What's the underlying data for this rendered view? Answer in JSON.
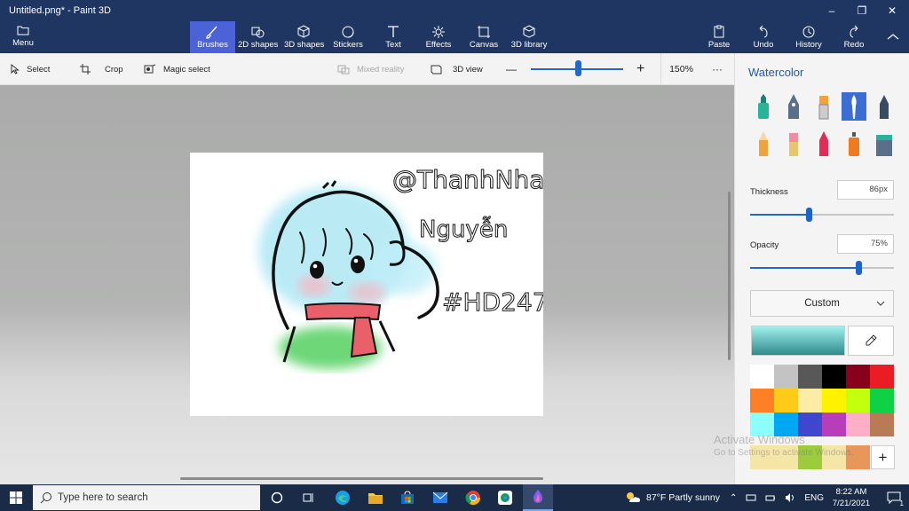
{
  "window": {
    "title": "Untitled.png* - Paint 3D",
    "controls": {
      "minimize": "–",
      "maximize": "❐",
      "close": "✕"
    }
  },
  "ribbon": {
    "menu_label": "Menu",
    "tools": [
      {
        "label": "Brushes",
        "icon": "brush-icon",
        "active": true
      },
      {
        "label": "2D shapes",
        "icon": "2d-shapes-icon"
      },
      {
        "label": "3D shapes",
        "icon": "3d-shapes-icon"
      },
      {
        "label": "Stickers",
        "icon": "stickers-icon"
      },
      {
        "label": "Text",
        "icon": "text-icon"
      },
      {
        "label": "Effects",
        "icon": "effects-icon"
      },
      {
        "label": "Canvas",
        "icon": "canvas-icon"
      },
      {
        "label": "3D library",
        "icon": "3d-library-icon"
      }
    ],
    "actions": [
      {
        "label": "Paste",
        "icon": "paste-icon"
      },
      {
        "label": "Undo",
        "icon": "undo-icon"
      },
      {
        "label": "History",
        "icon": "history-icon"
      },
      {
        "label": "Redo",
        "icon": "redo-icon"
      }
    ]
  },
  "toolbar": {
    "select_label": "Select",
    "crop_label": "Crop",
    "magic_select_label": "Magic select",
    "mixed_reality_label": "Mixed reality",
    "view_3d_label": "3D view",
    "zoom_minus": "—",
    "zoom_plus": "+",
    "zoom_value": "150%",
    "more": "···"
  },
  "canvas_text": {
    "line1": "@ThanhNhan",
    "line2": "Nguyễn",
    "line3": "#HD247"
  },
  "panel": {
    "title": "Watercolor",
    "selected_brush": "watercolor-brush",
    "thickness_label": "Thickness",
    "thickness_value": "86px",
    "thickness_fraction": 0.41,
    "opacity_label": "Opacity",
    "opacity_value": "75%",
    "opacity_fraction": 0.75,
    "color_mode": "Custom",
    "current_color_top": "#9ff0ee",
    "current_color_bottom": "#2f8a8a",
    "palette": [
      "#ffffff",
      "#c3c3c3",
      "#585858",
      "#000000",
      "#88001b",
      "#ec1c24",
      "#ff7f27",
      "#ffca18",
      "#fdeca6",
      "#fff200",
      "#c4ff0e",
      "#0ed145",
      "#8cfffb",
      "#00a8f3",
      "#3f48cc",
      "#b83dba",
      "#ffaec8",
      "#b97a56"
    ],
    "custom_colors": [
      "#f5e6a8",
      "#f5e6a8",
      "#9ccc3c",
      "#f5e6a8",
      "#e8965a"
    ],
    "add_color": "+"
  },
  "watermark": {
    "line1": "Activate Windows",
    "line2": "Go to Settings to activate Windows."
  },
  "taskbar": {
    "search_placeholder": "Type here to search",
    "weather": "87°F  Partly sunny",
    "language": "ENG",
    "time": "8:22 AM",
    "date": "7/21/2021",
    "notifications": "1"
  }
}
